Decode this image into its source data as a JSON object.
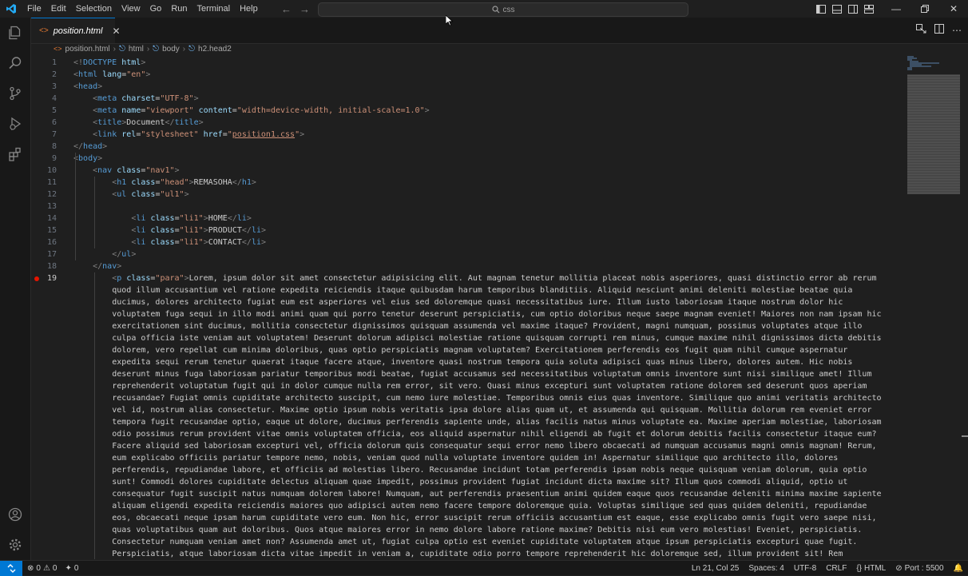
{
  "menu": [
    "File",
    "Edit",
    "Selection",
    "View",
    "Go",
    "Run",
    "Terminal",
    "Help"
  ],
  "search": {
    "placeholder": "css"
  },
  "tab": {
    "label": "position.html"
  },
  "breadcrumb": [
    "position.html",
    "html",
    "body",
    "h2.head2"
  ],
  "code_lines": [
    {
      "n": 1,
      "indent": 0,
      "tokens": [
        [
          "p",
          "<!"
        ],
        [
          "t",
          "DOCTYPE"
        ],
        [
          "a",
          " html"
        ],
        [
          "p",
          ">"
        ]
      ]
    },
    {
      "n": 2,
      "indent": 0,
      "tokens": [
        [
          "p",
          "<"
        ],
        [
          "t",
          "html"
        ],
        [
          "a",
          " lang"
        ],
        [
          "x",
          "="
        ],
        [
          "s",
          "\"en\""
        ],
        [
          "p",
          ">"
        ]
      ]
    },
    {
      "n": 3,
      "indent": 0,
      "tokens": [
        [
          "p",
          "<"
        ],
        [
          "t",
          "head"
        ],
        [
          "p",
          ">"
        ]
      ]
    },
    {
      "n": 4,
      "indent": 1,
      "tokens": [
        [
          "p",
          "<"
        ],
        [
          "t",
          "meta"
        ],
        [
          "a",
          " charset"
        ],
        [
          "x",
          "="
        ],
        [
          "s",
          "\"UTF-8\""
        ],
        [
          "p",
          ">"
        ]
      ]
    },
    {
      "n": 5,
      "indent": 1,
      "tokens": [
        [
          "p",
          "<"
        ],
        [
          "t",
          "meta"
        ],
        [
          "a",
          " name"
        ],
        [
          "x",
          "="
        ],
        [
          "s",
          "\"viewport\""
        ],
        [
          "a",
          " content"
        ],
        [
          "x",
          "="
        ],
        [
          "s",
          "\"width=device-width, initial-scale=1.0\""
        ],
        [
          "p",
          ">"
        ]
      ]
    },
    {
      "n": 6,
      "indent": 1,
      "tokens": [
        [
          "p",
          "<"
        ],
        [
          "t",
          "title"
        ],
        [
          "p",
          ">"
        ],
        [
          "x",
          "Document"
        ],
        [
          "p",
          "</"
        ],
        [
          "t",
          "title"
        ],
        [
          "p",
          ">"
        ]
      ]
    },
    {
      "n": 7,
      "indent": 1,
      "tokens": [
        [
          "p",
          "<"
        ],
        [
          "t",
          "link"
        ],
        [
          "a",
          " rel"
        ],
        [
          "x",
          "="
        ],
        [
          "s",
          "\"stylesheet\""
        ],
        [
          "a",
          " href"
        ],
        [
          "x",
          "="
        ],
        [
          "s",
          "\""
        ],
        [
          "u",
          "position1.css"
        ],
        [
          "s",
          "\""
        ],
        [
          "p",
          ">"
        ]
      ]
    },
    {
      "n": 8,
      "indent": 0,
      "tokens": [
        [
          "p",
          "</"
        ],
        [
          "t",
          "head"
        ],
        [
          "p",
          ">"
        ]
      ]
    },
    {
      "n": 9,
      "indent": 0,
      "tokens": [
        [
          "p",
          "<"
        ],
        [
          "t",
          "body"
        ],
        [
          "p",
          ">"
        ]
      ]
    },
    {
      "n": 10,
      "indent": 1,
      "tokens": [
        [
          "p",
          "<"
        ],
        [
          "t",
          "nav"
        ],
        [
          "a",
          " class"
        ],
        [
          "x",
          "="
        ],
        [
          "s",
          "\"nav1\""
        ],
        [
          "p",
          ">"
        ]
      ]
    },
    {
      "n": 11,
      "indent": 2,
      "tokens": [
        [
          "p",
          "<"
        ],
        [
          "t",
          "h1"
        ],
        [
          "a",
          " class"
        ],
        [
          "x",
          "="
        ],
        [
          "s",
          "\"head\""
        ],
        [
          "p",
          ">"
        ],
        [
          "x",
          "REMASOHA"
        ],
        [
          "p",
          "</"
        ],
        [
          "t",
          "h1"
        ],
        [
          "p",
          ">"
        ]
      ]
    },
    {
      "n": 12,
      "indent": 2,
      "tokens": [
        [
          "p",
          "<"
        ],
        [
          "t",
          "ul"
        ],
        [
          "a",
          " class"
        ],
        [
          "x",
          "="
        ],
        [
          "s",
          "\"ul1\""
        ],
        [
          "p",
          ">"
        ]
      ]
    },
    {
      "n": 13,
      "indent": 0,
      "tokens": []
    },
    {
      "n": 14,
      "indent": 3,
      "tokens": [
        [
          "p",
          "<"
        ],
        [
          "t",
          "li"
        ],
        [
          "a",
          " class"
        ],
        [
          "x",
          "="
        ],
        [
          "s",
          "\"li1\""
        ],
        [
          "p",
          ">"
        ],
        [
          "x",
          "HOME"
        ],
        [
          "p",
          "</"
        ],
        [
          "t",
          "li"
        ],
        [
          "p",
          ">"
        ]
      ]
    },
    {
      "n": 15,
      "indent": 3,
      "tokens": [
        [
          "p",
          "<"
        ],
        [
          "t",
          "li"
        ],
        [
          "a",
          " class"
        ],
        [
          "x",
          "="
        ],
        [
          "s",
          "\"li1\""
        ],
        [
          "p",
          ">"
        ],
        [
          "x",
          "PRODUCT"
        ],
        [
          "p",
          "</"
        ],
        [
          "t",
          "li"
        ],
        [
          "p",
          ">"
        ]
      ]
    },
    {
      "n": 16,
      "indent": 3,
      "tokens": [
        [
          "p",
          "<"
        ],
        [
          "t",
          "li"
        ],
        [
          "a",
          " class"
        ],
        [
          "x",
          "="
        ],
        [
          "s",
          "\"li1\""
        ],
        [
          "p",
          ">"
        ],
        [
          "x",
          "CONTACT"
        ],
        [
          "p",
          "</"
        ],
        [
          "t",
          "li"
        ],
        [
          "p",
          ">"
        ]
      ]
    },
    {
      "n": 17,
      "indent": 2,
      "tokens": [
        [
          "p",
          "</"
        ],
        [
          "t",
          "ul"
        ],
        [
          "p",
          ">"
        ]
      ]
    },
    {
      "n": 18,
      "indent": 1,
      "tokens": [
        [
          "p",
          "</"
        ],
        [
          "t",
          "nav"
        ],
        [
          "p",
          ">"
        ]
      ]
    },
    {
      "n": 19,
      "indent": 2,
      "breakpoint": true,
      "tokens": [
        [
          "p",
          "<"
        ],
        [
          "t",
          "p"
        ],
        [
          "a",
          " class"
        ],
        [
          "x",
          "="
        ],
        [
          "s",
          "\"para\""
        ],
        [
          "p",
          ">"
        ],
        [
          "x",
          "Lorem, ipsum dolor sit amet consectetur adipisicing elit. Aut magnam tenetur mollitia placeat nobis asperiores, quasi distinctio error ab rerum"
        ]
      ]
    }
  ],
  "wrapped_lines": [
    "quod illum accusantium vel ratione expedita reiciendis itaque quibusdam harum temporibus blanditiis. Aliquid nesciunt animi deleniti molestiae beatae quia",
    "ducimus, dolores architecto fugiat eum est asperiores vel eius sed doloremque quasi necessitatibus iure. Illum iusto laboriosam itaque nostrum dolor hic",
    "voluptatem fuga sequi in illo modi animi quam qui porro tenetur deserunt perspiciatis, cum optio doloribus neque saepe magnam eveniet! Maiores non nam ipsam hic",
    "exercitationem sint ducimus, mollitia consectetur dignissimos quisquam assumenda vel maxime itaque? Provident, magni numquam, possimus voluptates atque illo",
    "culpa officia iste veniam aut voluptatem! Deserunt dolorum adipisci molestiae ratione quisquam corrupti rem minus, cumque maxime nihil dignissimos dicta debitis",
    "dolorem, vero repellat cum minima doloribus, quas optio perspiciatis magnam voluptatem? Exercitationem perferendis eos fugit quam nihil cumque aspernatur",
    "expedita sequi rerum tenetur quaerat itaque facere atque, inventore quasi nostrum tempora quia soluta adipisci quas minus libero, dolores autem. Hic nobis",
    "deserunt minus fuga laboriosam pariatur temporibus modi beatae, fugiat accusamus sed necessitatibus voluptatum omnis inventore sunt nisi similique amet! Illum",
    "reprehenderit voluptatum fugit qui in dolor cumque nulla rem error, sit vero. Quasi minus excepturi sunt voluptatem ratione dolorem sed deserunt quos aperiam",
    "recusandae? Fugiat omnis cupiditate architecto suscipit, cum nemo iure molestiae. Temporibus omnis eius quas inventore. Similique quo animi veritatis architecto",
    "vel id, nostrum alias consectetur. Maxime optio ipsum nobis veritatis ipsa dolore alias quam ut, et assumenda qui quisquam. Mollitia dolorum rem eveniet error",
    "tempora fugit recusandae optio, eaque ut dolore, ducimus perferendis sapiente unde, alias facilis natus minus voluptate ea. Maxime aperiam molestiae, laboriosam",
    "odio possimus rerum provident vitae omnis voluptatem officia, eos aliquid aspernatur nihil eligendi ab fugit et dolorum debitis facilis consectetur itaque eum?",
    "Facere aliquid sed laboriosam excepturi vel, officia dolorum quis consequatur sequi error nemo libero obcaecati ad numquam accusamus magni omnis magnam! Rerum,",
    "eum explicabo officiis pariatur tempore nemo, nobis, veniam quod nulla voluptate inventore quidem in! Aspernatur similique quo architecto illo, dolores",
    "perferendis, repudiandae labore, et officiis ad molestias libero. Recusandae incidunt totam perferendis ipsam nobis neque quisquam veniam dolorum, quia optio",
    "sunt! Commodi dolores cupiditate delectus aliquam quae impedit, possimus provident fugiat incidunt dicta maxime sit? Illum quos commodi aliquid, optio ut",
    "consequatur fugit suscipit natus numquam dolorem labore! Numquam, aut perferendis praesentium animi quidem eaque quos recusandae deleniti minima maxime sapiente",
    "aliquam eligendi expedita reiciendis maiores quo adipisci autem nemo facere tempore doloremque quia. Voluptas similique sed quas quidem deleniti, repudiandae",
    "eos, obcaecati neque ipsam harum cupiditate vero eum. Non hic, error suscipit rerum officiis accusantium est eaque, esse explicabo omnis fugit vero saepe nisi,",
    "quas voluptatibus quam aut doloribus. Quos atque maiores error in nemo dolore labore ratione maxime? Debitis nisi eum vero molestias! Eveniet, perspiciatis.",
    "Consectetur numquam veniam amet non? Assumenda amet ut, fugiat culpa optio est eveniet cupiditate voluptatem atque ipsum perspiciatis excepturi quae fugit.",
    "Perspiciatis, atque laboriosam dicta vitae impedit in veniam a, cupiditate odio porro tempore reprehenderit hic doloremque sed, illum provident sit! Rem"
  ],
  "status": {
    "errors": "0",
    "warnings": "0",
    "ports": "0",
    "position": "Ln 21, Col 25",
    "spaces": "Spaces: 4",
    "encoding": "UTF-8",
    "eol": "CRLF",
    "language": "HTML",
    "port": "Port : 5500"
  },
  "colors": {
    "accent": "#0078d4",
    "breakpoint": "#e51400",
    "tag": "#569cd6",
    "attr": "#9cdcfe",
    "string": "#ce9178"
  }
}
